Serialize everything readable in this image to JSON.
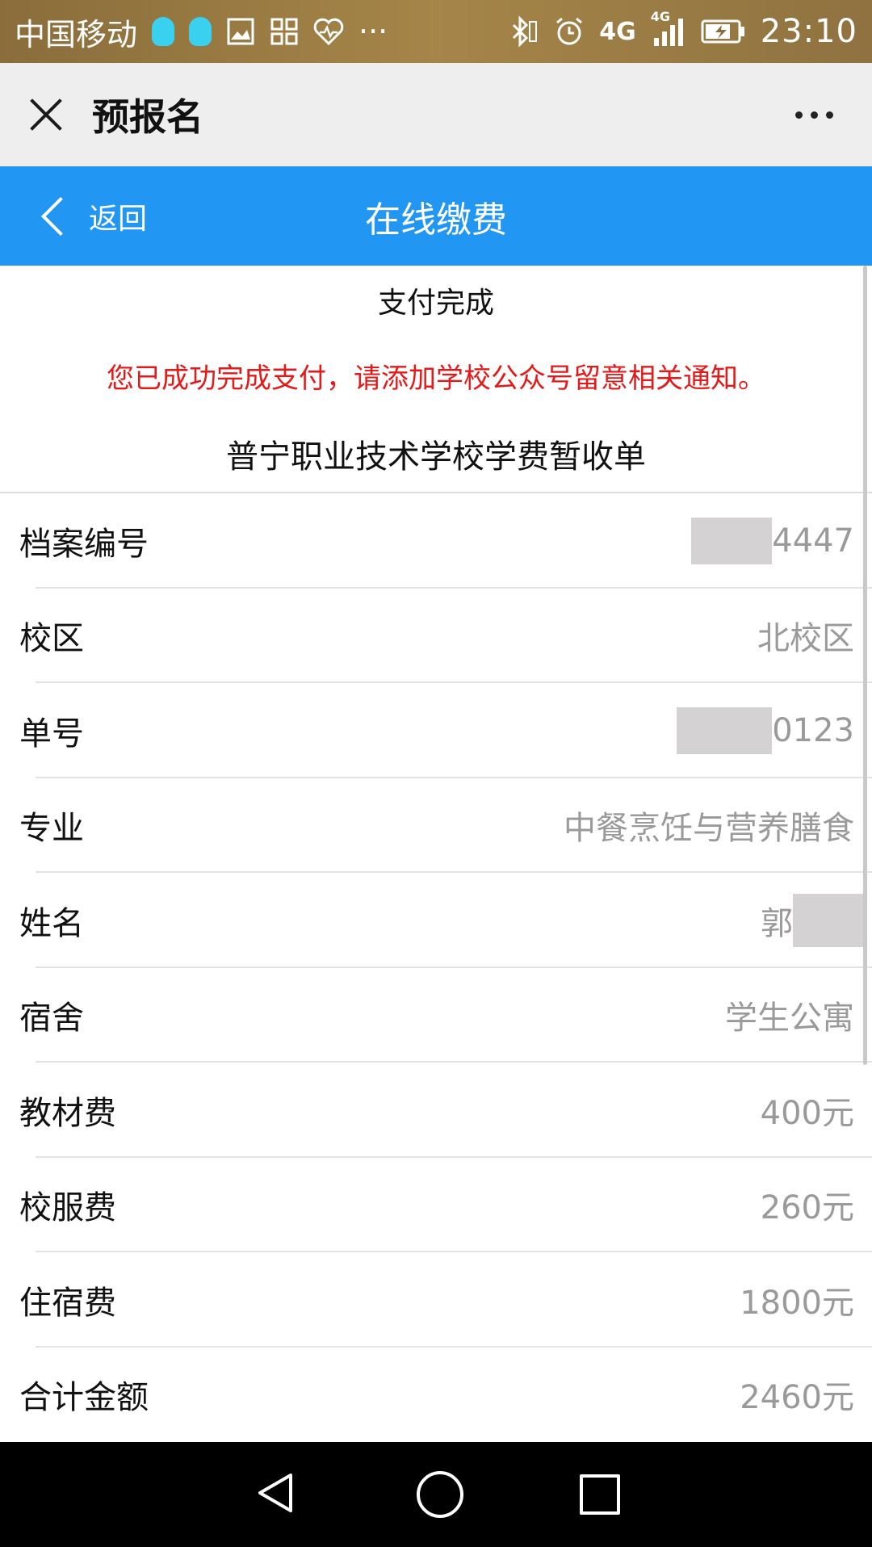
{
  "status_bar": {
    "carrier": "中国移动",
    "time": "23:10",
    "network_label": "4G",
    "network_label_small": "4G",
    "overflow_glyph": "···",
    "icons": [
      "qq-icon",
      "qq-icon",
      "gallery-icon",
      "apps-icon",
      "health-icon",
      "bluetooth-icon",
      "alarm-icon",
      "signal-icon",
      "battery-charging-icon"
    ]
  },
  "titlebar": {
    "title": "预报名",
    "close_icon": "close-icon",
    "more_icon": "more-icon"
  },
  "header": {
    "back_label": "返回",
    "title": "在线缴费",
    "bg_color": "#2196f3"
  },
  "payment": {
    "status": "支付完成",
    "notice": "您已成功完成支付，请添加学校公众号留意相关通知。",
    "notice_color": "#e41a1a",
    "receipt_title": "普宁职业技术学校学费暂收单"
  },
  "fields": [
    {
      "label": "档案编号",
      "value": "4447",
      "redacted": "before"
    },
    {
      "label": "校区",
      "value": "北校区"
    },
    {
      "label": "单号",
      "value": "0123",
      "redacted": "before"
    },
    {
      "label": "专业",
      "value": "中餐烹饪与营养膳食"
    },
    {
      "label": "姓名",
      "value": "郭",
      "redacted": "after"
    },
    {
      "label": "宿舍",
      "value": "学生公寓"
    },
    {
      "label": "教材费",
      "value": "400元"
    },
    {
      "label": "校服费",
      "value": "260元"
    },
    {
      "label": "住宿费",
      "value": "1800元"
    },
    {
      "label": "合计金额",
      "value": "2460元"
    }
  ],
  "navbar": {
    "icons": [
      "back-triangle-icon",
      "home-circle-icon",
      "recent-square-icon"
    ]
  }
}
